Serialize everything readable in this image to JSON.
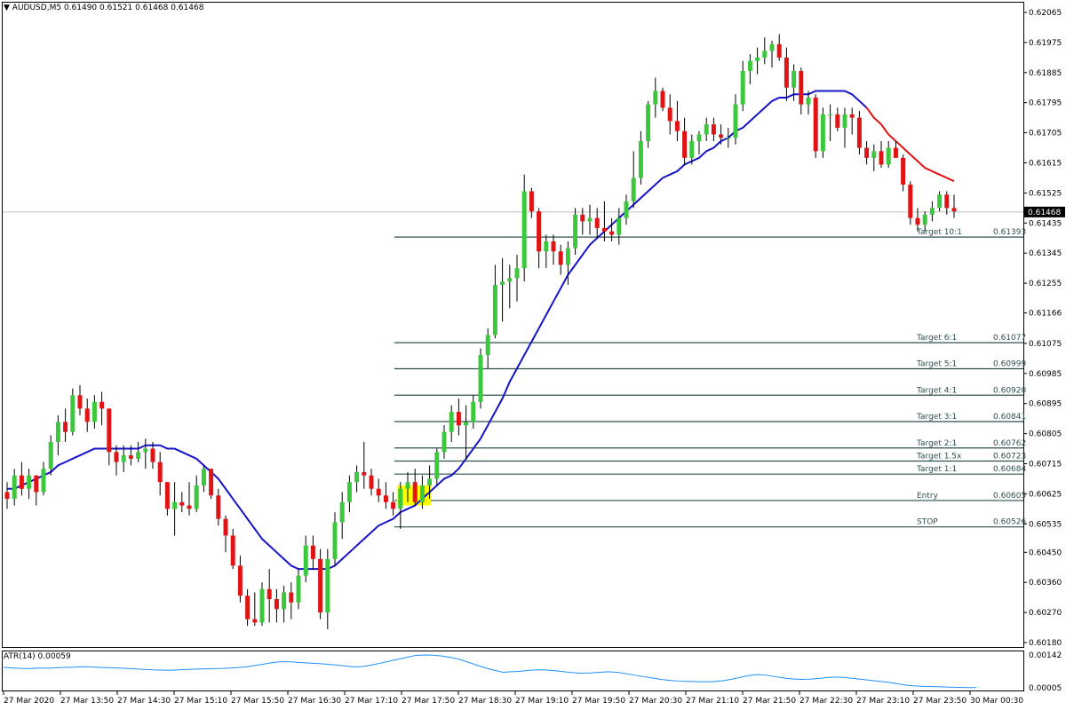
{
  "header": {
    "symbol_icon": "triangle-down-icon",
    "symbol": "AUDUSD,M5",
    "open": "0.61490",
    "high": "0.61521",
    "low": "0.61468",
    "close": "0.61468"
  },
  "price_scale": {
    "labels": [
      "0.62065",
      "0.61975",
      "0.61885",
      "0.61795",
      "0.61705",
      "0.61615",
      "0.61525",
      "0.61435",
      "0.61345",
      "0.61255",
      "0.61166",
      "0.61075",
      "0.60985",
      "0.60895",
      "0.60805",
      "0.60715",
      "0.60625",
      "0.60535",
      "0.60450",
      "0.60360",
      "0.60270",
      "0.60180"
    ],
    "current_price": "0.61468"
  },
  "atr": {
    "label": "ATR(14) 0.00059",
    "scale": [
      "0.00142",
      "0.00005"
    ]
  },
  "time_axis": [
    "27 Mar 2020",
    "27 Mar 13:50",
    "27 Mar 14:30",
    "27 Mar 15:10",
    "27 Mar 15:50",
    "27 Mar 16:30",
    "27 Mar 17:10",
    "27 Mar 17:50",
    "27 Mar 18:30",
    "27 Mar 19:10",
    "27 Mar 19:50",
    "27 Mar 20:30",
    "27 Mar 21:10",
    "27 Mar 21:50",
    "27 Mar 22:30",
    "27 Mar 23:10",
    "27 Mar 23:50",
    "30 Mar 00:30"
  ],
  "levels": [
    {
      "label": "Target 10:1",
      "value": "0.61393"
    },
    {
      "label": "Target 6:1",
      "value": "0.61077"
    },
    {
      "label": "Target 5:1",
      "value": "0.60999"
    },
    {
      "label": "Target 4:1",
      "value": "0.60920"
    },
    {
      "label": "Target 3:1",
      "value": "0.60841"
    },
    {
      "label": "Target 2:1",
      "value": "0.60762"
    },
    {
      "label": "Target 1.5x",
      "value": "0.60723"
    },
    {
      "label": "Target 1:1",
      "value": "0.60684"
    },
    {
      "label": "Entry",
      "value": "0.60605"
    },
    {
      "label": "STOP",
      "value": "0.60526"
    }
  ],
  "colors": {
    "bull": "#3cc83c",
    "bear": "#e01414",
    "ma_up": "#1414c8",
    "ma_down": "#e01414",
    "level_line": "#2f4f4f",
    "highlight": "#ffff00",
    "atr_line": "#1e90ff"
  },
  "chart_data": {
    "type": "candlestick",
    "symbol": "AUDUSD",
    "timeframe": "M5",
    "ylim": [
      0.6018,
      0.62065
    ],
    "x_ticks": [
      "27 Mar 2020",
      "27 Mar 13:50",
      "27 Mar 14:30",
      "27 Mar 15:10",
      "27 Mar 15:50",
      "27 Mar 16:30",
      "27 Mar 17:10",
      "27 Mar 17:50",
      "27 Mar 18:30",
      "27 Mar 19:10",
      "27 Mar 19:50",
      "27 Mar 20:30",
      "27 Mar 21:10",
      "27 Mar 21:50",
      "27 Mar 22:30",
      "27 Mar 23:10",
      "27 Mar 23:50",
      "30 Mar 00:30"
    ],
    "candles": [
      [
        0.6063,
        0.6066,
        0.6058,
        0.6061
      ],
      [
        0.6061,
        0.607,
        0.6059,
        0.6068
      ],
      [
        0.6068,
        0.6072,
        0.6062,
        0.6064
      ],
      [
        0.6064,
        0.607,
        0.6061,
        0.6068
      ],
      [
        0.6068,
        0.6068,
        0.6059,
        0.6063
      ],
      [
        0.6063,
        0.6072,
        0.6062,
        0.607
      ],
      [
        0.607,
        0.608,
        0.6068,
        0.6078
      ],
      [
        0.6078,
        0.6086,
        0.6074,
        0.6084
      ],
      [
        0.6084,
        0.6088,
        0.6078,
        0.6081
      ],
      [
        0.6081,
        0.6094,
        0.608,
        0.6092
      ],
      [
        0.6092,
        0.6095,
        0.6086,
        0.6088
      ],
      [
        0.6088,
        0.6091,
        0.6081,
        0.6084
      ],
      [
        0.6084,
        0.6092,
        0.6082,
        0.609
      ],
      [
        0.609,
        0.6093,
        0.6083,
        0.6088
      ],
      [
        0.6088,
        0.6088,
        0.6071,
        0.6075
      ],
      [
        0.6075,
        0.6077,
        0.6068,
        0.6072
      ],
      [
        0.6072,
        0.6077,
        0.6069,
        0.6074
      ],
      [
        0.6074,
        0.6077,
        0.6071,
        0.6073
      ],
      [
        0.6073,
        0.6078,
        0.6072,
        0.6075
      ],
      [
        0.6075,
        0.6079,
        0.607,
        0.6076
      ],
      [
        0.6076,
        0.6078,
        0.607,
        0.6072
      ],
      [
        0.6072,
        0.6075,
        0.6062,
        0.6066
      ],
      [
        0.6066,
        0.6066,
        0.6056,
        0.6058
      ],
      [
        0.6058,
        0.6066,
        0.605,
        0.606
      ],
      [
        0.606,
        0.6063,
        0.6057,
        0.6059
      ],
      [
        0.6059,
        0.6066,
        0.6056,
        0.6058
      ],
      [
        0.6058,
        0.6068,
        0.6057,
        0.6065
      ],
      [
        0.6065,
        0.6071,
        0.6063,
        0.607
      ],
      [
        0.607,
        0.607,
        0.6061,
        0.6062
      ],
      [
        0.6062,
        0.6064,
        0.6053,
        0.6055
      ],
      [
        0.6055,
        0.6056,
        0.6045,
        0.605
      ],
      [
        0.605,
        0.6052,
        0.604,
        0.6041
      ],
      [
        0.6041,
        0.6044,
        0.603,
        0.6032
      ],
      [
        0.6032,
        0.6034,
        0.6023,
        0.6025
      ],
      [
        0.6025,
        0.6033,
        0.6023,
        0.6024
      ],
      [
        0.6024,
        0.6036,
        0.6023,
        0.6034
      ],
      [
        0.6034,
        0.604,
        0.6024,
        0.6031
      ],
      [
        0.6031,
        0.6034,
        0.6024,
        0.6028
      ],
      [
        0.6028,
        0.6035,
        0.6024,
        0.6033
      ],
      [
        0.6033,
        0.6036,
        0.6025,
        0.603
      ],
      [
        0.603,
        0.604,
        0.6028,
        0.6038
      ],
      [
        0.6038,
        0.605,
        0.6036,
        0.6047
      ],
      [
        0.6047,
        0.605,
        0.604,
        0.6043
      ],
      [
        0.6043,
        0.6046,
        0.6025,
        0.6027
      ],
      [
        0.6027,
        0.6046,
        0.6022,
        0.6043
      ],
      [
        0.6043,
        0.6057,
        0.6041,
        0.6054
      ],
      [
        0.6054,
        0.6063,
        0.6049,
        0.606
      ],
      [
        0.606,
        0.6068,
        0.6057,
        0.6066
      ],
      [
        0.6066,
        0.6071,
        0.6063,
        0.6069
      ],
      [
        0.6069,
        0.6078,
        0.6064,
        0.6068
      ],
      [
        0.6068,
        0.607,
        0.6062,
        0.6064
      ],
      [
        0.6064,
        0.6067,
        0.606,
        0.6062
      ],
      [
        0.6062,
        0.6066,
        0.6058,
        0.606
      ],
      [
        0.606,
        0.6063,
        0.6056,
        0.6058
      ],
      [
        0.6058,
        0.6066,
        0.6052,
        0.6064
      ],
      [
        0.6064,
        0.6069,
        0.606,
        0.6066
      ],
      [
        0.6066,
        0.607,
        0.6059,
        0.606
      ],
      [
        0.606,
        0.6068,
        0.6058,
        0.6065
      ],
      [
        0.6065,
        0.6071,
        0.6061,
        0.6067
      ],
      [
        0.6067,
        0.6076,
        0.6065,
        0.6075
      ],
      [
        0.6075,
        0.6083,
        0.6073,
        0.6081
      ],
      [
        0.6081,
        0.6089,
        0.6078,
        0.6087
      ],
      [
        0.6087,
        0.6091,
        0.608,
        0.6083
      ],
      [
        0.6083,
        0.6089,
        0.6073,
        0.6084
      ],
      [
        0.6084,
        0.6092,
        0.6082,
        0.609
      ],
      [
        0.609,
        0.6106,
        0.6088,
        0.6104
      ],
      [
        0.6104,
        0.6112,
        0.61,
        0.611
      ],
      [
        0.611,
        0.6131,
        0.6109,
        0.6125
      ],
      [
        0.6125,
        0.6133,
        0.6114,
        0.6126
      ],
      [
        0.6126,
        0.6131,
        0.6118,
        0.6127
      ],
      [
        0.6127,
        0.6134,
        0.612,
        0.613
      ],
      [
        0.613,
        0.6158,
        0.6126,
        0.6153
      ],
      [
        0.6153,
        0.6154,
        0.6145,
        0.6147
      ],
      [
        0.6147,
        0.6148,
        0.613,
        0.6135
      ],
      [
        0.6135,
        0.614,
        0.613,
        0.6138
      ],
      [
        0.6138,
        0.614,
        0.6131,
        0.6135
      ],
      [
        0.6135,
        0.6137,
        0.6128,
        0.6131
      ],
      [
        0.6131,
        0.6138,
        0.6125,
        0.6136
      ],
      [
        0.6136,
        0.6148,
        0.6134,
        0.6146
      ],
      [
        0.6146,
        0.6148,
        0.614,
        0.6144
      ],
      [
        0.6144,
        0.6149,
        0.614,
        0.6145
      ],
      [
        0.6145,
        0.6148,
        0.6139,
        0.6142
      ],
      [
        0.6142,
        0.615,
        0.6138,
        0.6141
      ],
      [
        0.6141,
        0.6145,
        0.6138,
        0.614
      ],
      [
        0.614,
        0.6148,
        0.6137,
        0.6145
      ],
      [
        0.6145,
        0.6152,
        0.6143,
        0.615
      ],
      [
        0.615,
        0.6165,
        0.6148,
        0.6157
      ],
      [
        0.6157,
        0.6171,
        0.6155,
        0.6168
      ],
      [
        0.6168,
        0.618,
        0.6166,
        0.6179
      ],
      [
        0.6179,
        0.6187,
        0.6175,
        0.6183
      ],
      [
        0.6183,
        0.6184,
        0.6177,
        0.6178
      ],
      [
        0.6178,
        0.6182,
        0.617,
        0.6174
      ],
      [
        0.6174,
        0.618,
        0.6168,
        0.6171
      ],
      [
        0.6171,
        0.6175,
        0.6161,
        0.6163
      ],
      [
        0.6163,
        0.617,
        0.6161,
        0.6168
      ],
      [
        0.6168,
        0.6171,
        0.6164,
        0.617
      ],
      [
        0.617,
        0.6175,
        0.6168,
        0.6173
      ],
      [
        0.6173,
        0.6175,
        0.6168,
        0.617
      ],
      [
        0.617,
        0.6173,
        0.6167,
        0.6169
      ],
      [
        0.6169,
        0.6172,
        0.6166,
        0.6169
      ],
      [
        0.6169,
        0.6182,
        0.6167,
        0.6179
      ],
      [
        0.6179,
        0.6192,
        0.6177,
        0.6189
      ],
      [
        0.6189,
        0.6194,
        0.6185,
        0.6192
      ],
      [
        0.6192,
        0.6196,
        0.6188,
        0.6193
      ],
      [
        0.6193,
        0.6199,
        0.6191,
        0.6195
      ],
      [
        0.6195,
        0.6198,
        0.619,
        0.6197
      ],
      [
        0.6197,
        0.62,
        0.6192,
        0.6193
      ],
      [
        0.6193,
        0.6196,
        0.618,
        0.6184
      ],
      [
        0.6184,
        0.6191,
        0.618,
        0.6189
      ],
      [
        0.6189,
        0.619,
        0.6176,
        0.6179
      ],
      [
        0.6179,
        0.6183,
        0.6176,
        0.6181
      ],
      [
        0.6181,
        0.6182,
        0.6163,
        0.6165
      ],
      [
        0.6165,
        0.6178,
        0.6163,
        0.6176
      ],
      [
        0.6176,
        0.6179,
        0.6168,
        0.6176
      ],
      [
        0.6176,
        0.6178,
        0.6171,
        0.6172
      ],
      [
        0.6172,
        0.6178,
        0.6166,
        0.6176
      ],
      [
        0.6176,
        0.6178,
        0.617,
        0.6175
      ],
      [
        0.6175,
        0.6177,
        0.6164,
        0.6166
      ],
      [
        0.6166,
        0.6168,
        0.6161,
        0.6163
      ],
      [
        0.6163,
        0.6167,
        0.6159,
        0.6165
      ],
      [
        0.6165,
        0.6168,
        0.616,
        0.6161
      ],
      [
        0.6161,
        0.6168,
        0.616,
        0.6166
      ],
      [
        0.6166,
        0.6168,
        0.6163,
        0.6163
      ],
      [
        0.6163,
        0.6164,
        0.6153,
        0.6155
      ],
      [
        0.6155,
        0.6156,
        0.6143,
        0.6145
      ],
      [
        0.6145,
        0.6148,
        0.6141,
        0.6143
      ],
      [
        0.6143,
        0.6147,
        0.6141,
        0.6146
      ],
      [
        0.6146,
        0.615,
        0.6144,
        0.6148
      ],
      [
        0.6148,
        0.6153,
        0.6147,
        0.6152
      ],
      [
        0.6152,
        0.6153,
        0.6146,
        0.6148
      ],
      [
        0.6148,
        0.6152,
        0.6145,
        0.6147
      ]
    ],
    "moving_average": {
      "name": "",
      "values": [
        0.6064,
        0.6064,
        0.6065,
        0.6066,
        0.6067,
        0.6068,
        0.6069,
        0.6071,
        0.6072,
        0.6073,
        0.6074,
        0.6075,
        0.6076,
        0.6076,
        0.6076,
        0.6076,
        0.6076,
        0.6076,
        0.6076,
        0.6077,
        0.6077,
        0.6077,
        0.6076,
        0.6076,
        0.6075,
        0.6074,
        0.6073,
        0.6071,
        0.6069,
        0.6067,
        0.6064,
        0.6061,
        0.6058,
        0.6055,
        0.6052,
        0.6049,
        0.6047,
        0.6045,
        0.6043,
        0.6041,
        0.604,
        0.604,
        0.604,
        0.604,
        0.604,
        0.6041,
        0.6043,
        0.6045,
        0.6047,
        0.6049,
        0.6051,
        0.6053,
        0.6054,
        0.6055,
        0.6057,
        0.6058,
        0.6059,
        0.6061,
        0.6063,
        0.6065,
        0.6067,
        0.6068,
        0.607,
        0.6073,
        0.6076,
        0.6079,
        0.6083,
        0.6087,
        0.6091,
        0.6096,
        0.61,
        0.6104,
        0.6108,
        0.6112,
        0.6116,
        0.612,
        0.6124,
        0.6128,
        0.6131,
        0.6134,
        0.6137,
        0.6139,
        0.6141,
        0.6143,
        0.6145,
        0.6147,
        0.6149,
        0.6151,
        0.6153,
        0.6155,
        0.6157,
        0.6158,
        0.6159,
        0.6161,
        0.6162,
        0.6163,
        0.6165,
        0.6166,
        0.6168,
        0.6169,
        0.6171,
        0.6172,
        0.6174,
        0.6176,
        0.6178,
        0.618,
        0.6181,
        0.6181,
        0.6182,
        0.6182,
        0.6182,
        0.6183,
        0.6183,
        0.6183,
        0.6183,
        0.6183,
        0.6182,
        0.618,
        0.6178,
        0.6175,
        0.6173,
        0.617,
        0.6168,
        0.6166,
        0.6164,
        0.6162,
        0.616,
        0.6159,
        0.6158,
        0.6157,
        0.6156
      ]
    },
    "atr": {
      "name": "ATR(14)",
      "last": 0.00059,
      "ylim": [
        5e-05,
        0.00142
      ],
      "values": [
        0.0009,
        0.00088,
        0.00086,
        0.00085,
        0.00088,
        0.00087,
        0.00089,
        0.0009,
        0.00091,
        0.00093,
        0.00092,
        0.0009,
        0.00089,
        0.00088,
        0.00086,
        0.00084,
        0.00082,
        0.0008,
        0.00079,
        0.00078,
        0.0008,
        0.00082,
        0.00083,
        0.00084,
        0.00085,
        0.00086,
        0.00088,
        0.0009,
        0.00094,
        0.001,
        0.00106,
        0.00112,
        0.00114,
        0.00113,
        0.0011,
        0.00108,
        0.00106,
        0.00103,
        0.001,
        0.00096,
        0.00092,
        0.00094,
        0.001,
        0.00108,
        0.00116,
        0.00124,
        0.00132,
        0.0014,
        0.00142,
        0.00141,
        0.00138,
        0.00132,
        0.00124,
        0.00112,
        0.001,
        0.00088,
        0.00078,
        0.0007,
        0.00072,
        0.00074,
        0.00078,
        0.0008,
        0.00079,
        0.00076,
        0.00072,
        0.00068,
        0.00066,
        0.00067,
        0.0007,
        0.00072,
        0.0007,
        0.00064,
        0.00058,
        0.00052,
        0.00046,
        0.0004,
        0.00036,
        0.00033,
        0.00032,
        0.00031,
        0.0003,
        0.00031,
        0.00034,
        0.0004,
        0.00048,
        0.00056,
        0.0006,
        0.00058,
        0.00052,
        0.00046,
        0.00042,
        0.0004,
        0.00041,
        0.00044,
        0.00048,
        0.0005,
        0.00048,
        0.00044,
        0.0004,
        0.00036,
        0.00032,
        0.00028,
        0.00022,
        0.00016,
        0.00013,
        0.00011,
        0.0001,
        9e-05,
        8e-05,
        7e-05,
        6e-05,
        6e-05
      ]
    },
    "levels": [
      {
        "label": "Target 10:1",
        "value": 0.61393
      },
      {
        "label": "Target 6:1",
        "value": 0.61077
      },
      {
        "label": "Target 5:1",
        "value": 0.60999
      },
      {
        "label": "Target 4:1",
        "value": 0.6092
      },
      {
        "label": "Target 3:1",
        "value": 0.60841
      },
      {
        "label": "Target 2:1",
        "value": 0.60762
      },
      {
        "label": "Target 1.5x",
        "value": 0.60723
      },
      {
        "label": "Target 1:1",
        "value": 0.60684
      },
      {
        "label": "Entry",
        "value": 0.60605
      },
      {
        "label": "STOP",
        "value": 0.60526
      }
    ],
    "current_price": 0.61468,
    "grid": false
  }
}
